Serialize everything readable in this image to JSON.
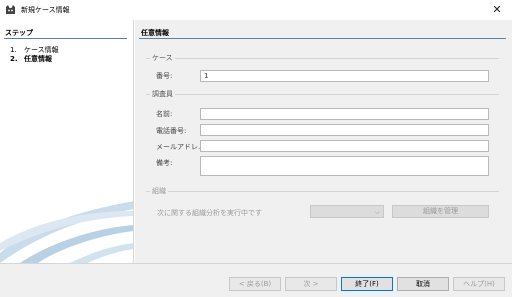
{
  "window": {
    "title": "新規ケース情報",
    "close_glyph": "✕",
    "icon": "cat-head-icon"
  },
  "steps": {
    "header": "ステップ",
    "items": [
      {
        "num": "1.",
        "label": "ケース情報"
      },
      {
        "num": "2.",
        "label": "任意情報"
      }
    ]
  },
  "panel": {
    "header": "任意情報",
    "case_group": {
      "title": "ケース",
      "number_label": "番号:",
      "number_value": "1"
    },
    "examiner_group": {
      "title": "調査員",
      "name_label": "名前:",
      "phone_label": "電話番号:",
      "email_label": "メールアドレ...",
      "notes_label": "備考:"
    },
    "org_group": {
      "title": "組織",
      "run_text": "次に関する組織分析を実行中です",
      "manage_button": "組織を管理"
    }
  },
  "footer": {
    "back": "< 戻る(B)",
    "next": "次 >",
    "finish": "終了(F)",
    "cancel": "取消",
    "help": "ヘルプ(H)"
  }
}
